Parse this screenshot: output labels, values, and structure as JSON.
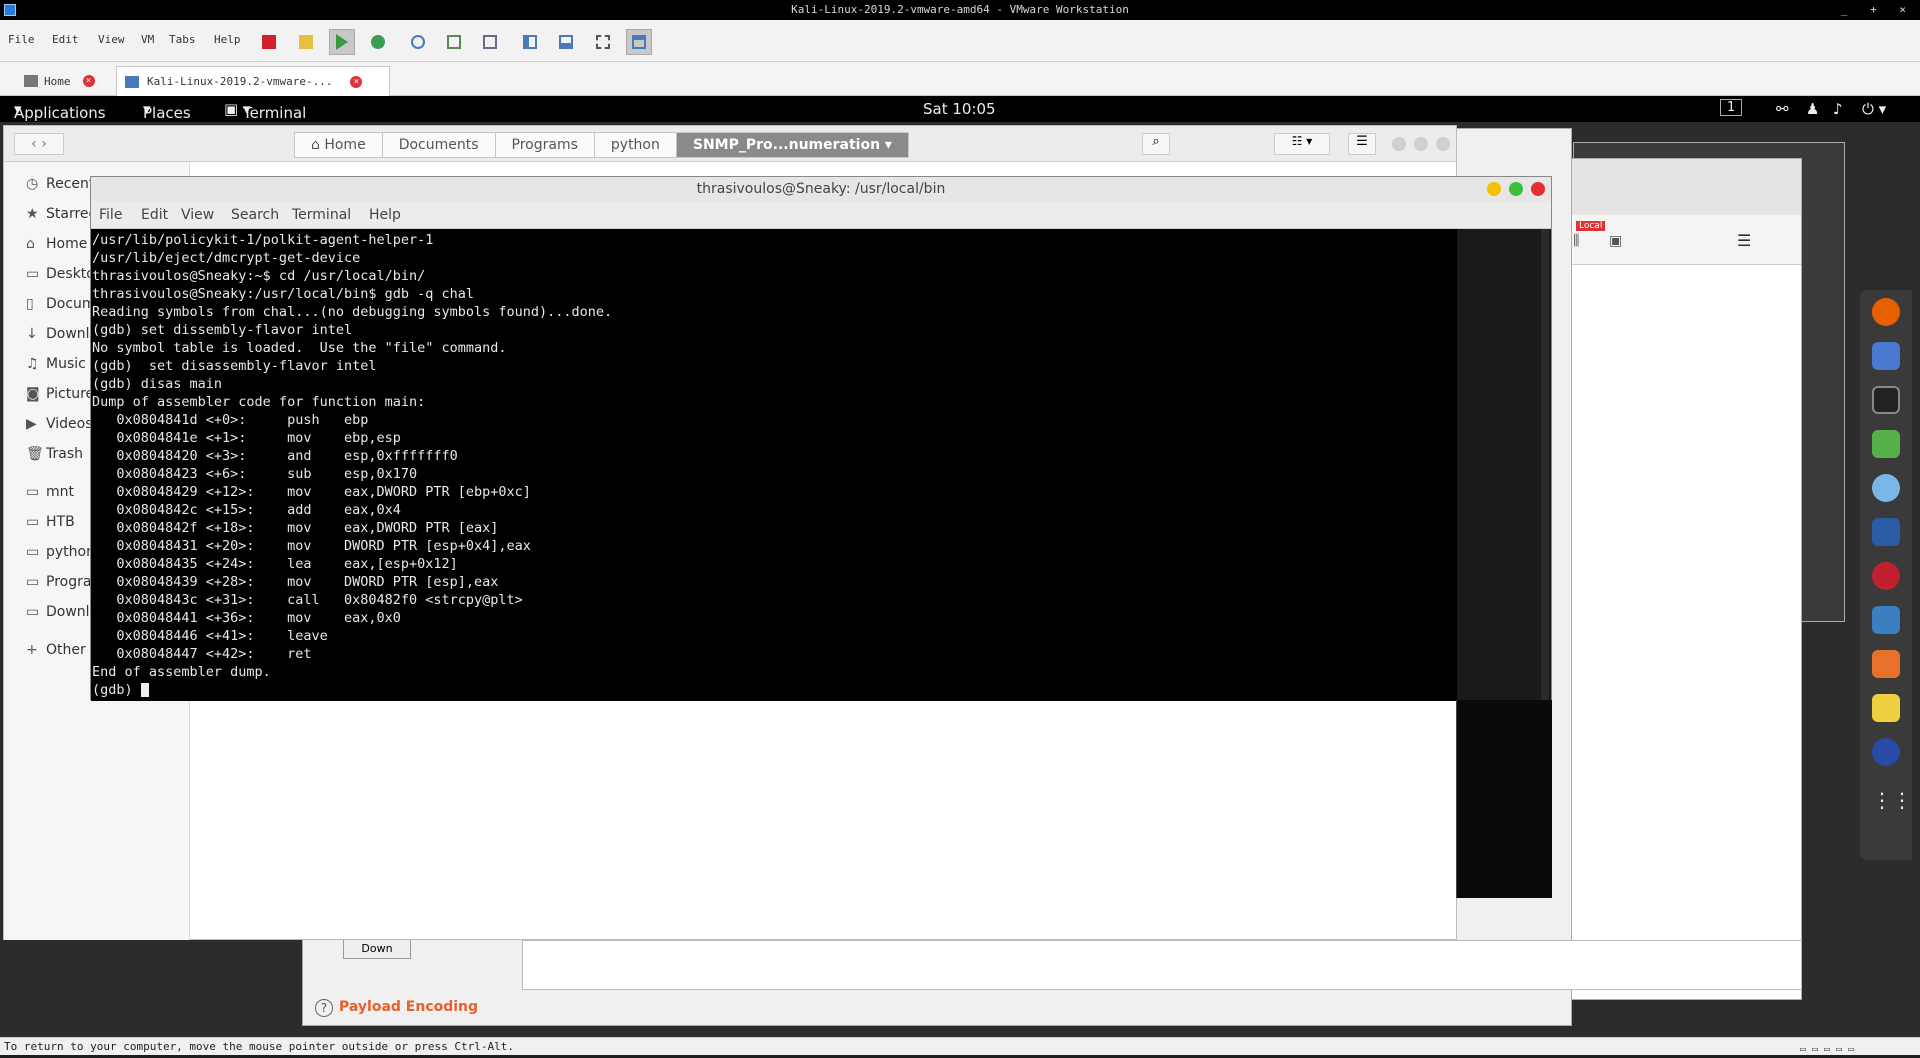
{
  "vm": {
    "window_title": "Kali-Linux-2019.2-vmware-amd64 - VMware Workstation",
    "window_controls": "_ + ×",
    "menu": [
      "File",
      "Edit",
      "View",
      "VM",
      "Tabs",
      "Help"
    ],
    "tabs": [
      {
        "label": "Home"
      },
      {
        "label": "Kali-Linux-2019.2-vmware-..."
      }
    ],
    "status_text": "To return to your computer, move the mouse pointer outside or press Ctrl-Alt."
  },
  "gnome": {
    "applications": "Applications",
    "places": "Places",
    "terminal": "Terminal",
    "clock": "Sat 10:05",
    "workspace": "1"
  },
  "files": {
    "breadcrumbs": [
      "Home",
      "Documents",
      "Programs",
      "python",
      "SNMP_Pro...numeration"
    ],
    "sidebar": [
      "Recent",
      "Starred",
      "Home",
      "Desktop",
      "Documents",
      "Downloads",
      "Music",
      "Pictures",
      "Videos",
      "Trash",
      "mnt",
      "HTB",
      "python",
      "Programs",
      "Downloads",
      "Other Locations"
    ]
  },
  "burp": {
    "down_button": "Down",
    "payload_encoding": "Payload Encoding"
  },
  "browser": {
    "badge": "Local"
  },
  "terminal": {
    "title": "thrasivoulos@Sneaky: /usr/local/bin",
    "menu": [
      "File",
      "Edit",
      "View",
      "Search",
      "Terminal",
      "Help"
    ],
    "lines": [
      "/usr/lib/policykit-1/polkit-agent-helper-1",
      "/usr/lib/eject/dmcrypt-get-device",
      "thrasivoulos@Sneaky:~$ cd /usr/local/bin/",
      "thrasivoulos@Sneaky:/usr/local/bin$ gdb -q chal",
      "Reading symbols from chal...(no debugging symbols found)...done.",
      "(gdb) set dissembly-flavor intel",
      "No symbol table is loaded.  Use the \"file\" command.",
      "(gdb)  set disassembly-flavor intel",
      "(gdb) disas main",
      "Dump of assembler code for function main:",
      "   0x0804841d <+0>:     push   ebp",
      "   0x0804841e <+1>:     mov    ebp,esp",
      "   0x08048420 <+3>:     and    esp,0xfffffff0",
      "   0x08048423 <+6>:     sub    esp,0x170",
      "   0x08048429 <+12>:    mov    eax,DWORD PTR [ebp+0xc]",
      "   0x0804842c <+15>:    add    eax,0x4",
      "   0x0804842f <+18>:    mov    eax,DWORD PTR [eax]",
      "   0x08048431 <+20>:    mov    DWORD PTR [esp+0x4],eax",
      "   0x08048435 <+24>:    lea    eax,[esp+0x12]",
      "   0x08048439 <+28>:    mov    DWORD PTR [esp],eax",
      "   0x0804843c <+31>:    call   0x80482f0 <strcpy@plt>",
      "   0x08048441 <+36>:    mov    eax,0x0",
      "   0x08048446 <+41>:    leave",
      "   0x08048447 <+42>:    ret",
      "End of assembler dump.",
      "(gdb) "
    ]
  }
}
